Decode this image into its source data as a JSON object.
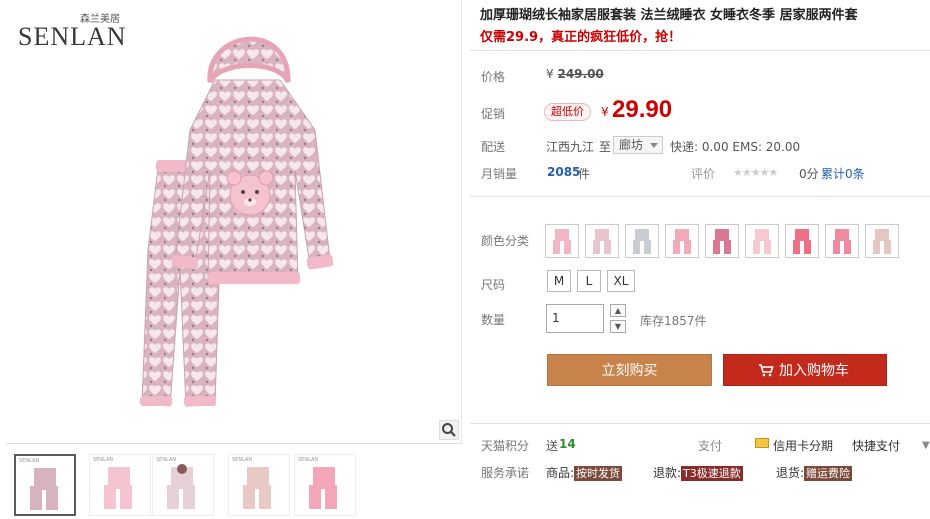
{
  "brand": {
    "cn": "森兰美居",
    "en": "SENLAN"
  },
  "product": {
    "title": "加厚珊瑚绒长袖家居服套装 法兰绒睡衣 女睡衣冬季 居家服两件套",
    "subtitle": "仅需29.9，真正的疯狂低价，抢！"
  },
  "price": {
    "label": "价格",
    "currency": "¥",
    "original": "249.00"
  },
  "promo": {
    "label": "促销",
    "badge": "超低价",
    "currency": "¥",
    "price": "29.90"
  },
  "shipping": {
    "label": "配送",
    "from": "江西九江",
    "to_word": "至",
    "destination": "廊坊",
    "fees": "快递: 0.00 EMS: 20.00"
  },
  "sales": {
    "label": "月销量",
    "count": "2085",
    "unit": "件",
    "rating_label": "评价",
    "stars": "★★★★★",
    "score": "0分",
    "review_link": "累计0条"
  },
  "color": {
    "label": "颜色分类",
    "swatch_colors": [
      "#f3b6c4",
      "#e8c4cc",
      "#c9cdd3",
      "#f2a9b8",
      "#d9788f",
      "#f7c8d2",
      "#ee6f86",
      "#f08aa0",
      "#e4c7c0"
    ]
  },
  "size": {
    "label": "尺码",
    "options": [
      "M",
      "L",
      "XL"
    ]
  },
  "quantity": {
    "label": "数量",
    "value": "1",
    "stock": "库存1857件"
  },
  "actions": {
    "buy_now": "立刻购买",
    "add_to_cart": "加入购物车"
  },
  "points": {
    "label": "天猫积分",
    "prefix": "送",
    "value": "14",
    "pay_label": "支付",
    "credit": "信用卡分期",
    "quick_pay": "快捷支付"
  },
  "service": {
    "label": "服务承诺",
    "goods_label": "商品:",
    "goods_tag": "按时发货",
    "refund_label": "退款:",
    "refund_tag": "T3极速退款",
    "return_label": "退货:",
    "return_tag": "赠运费险"
  },
  "thumbnails": {
    "count": 5,
    "tag": "SENLAN"
  },
  "icons": {
    "zoom": "magnifier-icon",
    "cart": "cart-icon",
    "credit": "credit-card-icon",
    "more": "chevron-down-icon"
  }
}
